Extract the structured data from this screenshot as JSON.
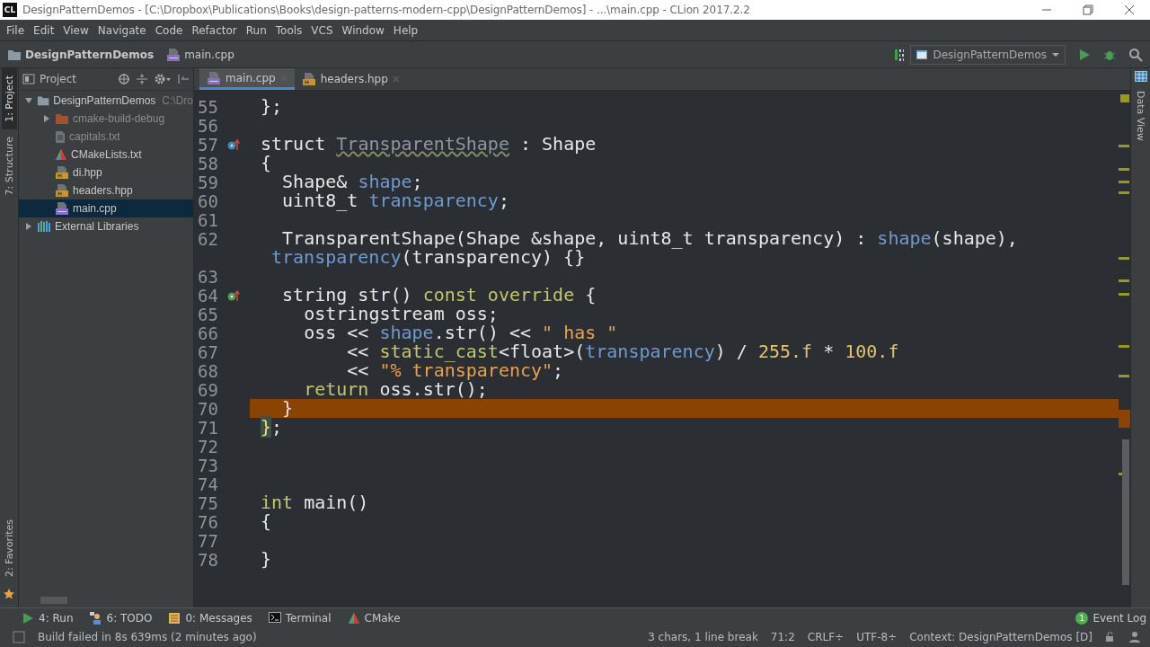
{
  "window": {
    "logo": "CL",
    "title": "DesignPatternDemos - [C:\\Dropbox\\Publications\\Books\\design-patterns-modern-cpp\\DesignPatternDemos] - ...\\main.cpp - CLion 2017.2.2"
  },
  "menu": [
    "File",
    "Edit",
    "View",
    "Navigate",
    "Code",
    "Refactor",
    "Run",
    "Tools",
    "VCS",
    "Window",
    "Help"
  ],
  "breadcrumbs": [
    {
      "kind": "folder",
      "label": "DesignPatternDemos"
    },
    {
      "kind": "cpp",
      "label": "main.cpp"
    }
  ],
  "run_config": {
    "label": "DesignPatternDemos"
  },
  "left_tool_windows": [
    {
      "label": "1: Project",
      "selected": true
    },
    {
      "label": "7: Structure",
      "selected": false
    }
  ],
  "left_bottom_tool_windows": [
    {
      "label": "2: Favorites",
      "selected": false
    }
  ],
  "right_tool_windows": [
    {
      "label": "Data View",
      "selected": false
    }
  ],
  "project_panel": {
    "title": "Project",
    "tree": [
      {
        "kind": "folder",
        "label": "DesignPatternDemos",
        "path": "C:\\Dro",
        "expanded": true,
        "selected": false,
        "excluded": false,
        "children": [
          {
            "kind": "excluded-folder",
            "label": "cmake-build-debug",
            "expanded": false,
            "selected": false,
            "excluded": true
          },
          {
            "kind": "text",
            "label": "capitals.txt",
            "selected": false,
            "excluded": true
          },
          {
            "kind": "cmake",
            "label": "CMakeLists.txt",
            "selected": false,
            "excluded": false
          },
          {
            "kind": "header",
            "label": "di.hpp",
            "selected": false,
            "excluded": false
          },
          {
            "kind": "header",
            "label": "headers.hpp",
            "selected": false,
            "excluded": false
          },
          {
            "kind": "cpp",
            "label": "main.cpp",
            "selected": true,
            "excluded": false
          }
        ]
      },
      {
        "kind": "libraries",
        "label": "External Libraries",
        "expanded": false,
        "selected": false,
        "excluded": false
      }
    ]
  },
  "editor_tabs": [
    {
      "kind": "cpp",
      "label": "main.cpp",
      "selected": true
    },
    {
      "kind": "header",
      "label": "headers.hpp",
      "selected": false
    }
  ],
  "code_lines": [
    {
      "kind": "line",
      "number": "55",
      "tokens": [
        {
          "kind": "plain",
          "text": "};"
        }
      ]
    },
    {
      "kind": "line",
      "number": "56"
    },
    {
      "kind": "overridden",
      "number": "57",
      "tokens": [
        {
          "kind": "plain",
          "text": "struct "
        },
        {
          "kind": "unused",
          "text": "TransparentShape"
        },
        {
          "kind": "plain",
          "text": " : Shape"
        }
      ]
    },
    {
      "kind": "line",
      "number": "58",
      "tokens": [
        {
          "kind": "plain",
          "text": "{"
        }
      ]
    },
    {
      "kind": "line",
      "number": "59",
      "tokens": [
        {
          "kind": "plain",
          "text": "  Shape& "
        },
        {
          "kind": "field",
          "text": "shape"
        },
        {
          "kind": "plain",
          "text": ";"
        }
      ]
    },
    {
      "kind": "line",
      "number": "60",
      "tokens": [
        {
          "kind": "plain",
          "text": "  uint8_t "
        },
        {
          "kind": "field",
          "text": "transparency"
        },
        {
          "kind": "plain",
          "text": ";"
        }
      ]
    },
    {
      "kind": "line",
      "number": "61"
    },
    {
      "kind": "line",
      "number": "62",
      "tokens": [
        {
          "kind": "plain",
          "text": "  TransparentShape(Shape &shape, uint8_t transparency) : "
        },
        {
          "kind": "field",
          "text": "shape"
        },
        {
          "kind": "plain",
          "text": "(shape),"
        }
      ]
    },
    {
      "kind": "wrap",
      "tokens": [
        {
          "kind": "field",
          "text": "transparency"
        },
        {
          "kind": "plain",
          "text": "(transparency) {}"
        }
      ]
    },
    {
      "kind": "line",
      "number": "63"
    },
    {
      "kind": "overriding",
      "number": "64",
      "tokens": [
        {
          "kind": "plain",
          "text": "  string str() "
        },
        {
          "kind": "keyword",
          "text": "const override"
        },
        {
          "kind": "plain",
          "text": " {"
        }
      ]
    },
    {
      "kind": "line",
      "number": "65",
      "tokens": [
        {
          "kind": "plain",
          "text": "    ostringstream oss;"
        }
      ]
    },
    {
      "kind": "line",
      "number": "66",
      "tokens": [
        {
          "kind": "plain",
          "text": "    oss << "
        },
        {
          "kind": "field",
          "text": "shape"
        },
        {
          "kind": "plain",
          "text": ".str() << "
        },
        {
          "kind": "string",
          "text": "\" has \""
        }
      ]
    },
    {
      "kind": "line",
      "number": "67",
      "tokens": [
        {
          "kind": "plain",
          "text": "        << "
        },
        {
          "kind": "keyword",
          "text": "static_cast"
        },
        {
          "kind": "plain",
          "text": "<float>("
        },
        {
          "kind": "field",
          "text": "transparency"
        },
        {
          "kind": "plain",
          "text": ") / "
        },
        {
          "kind": "number",
          "text": "255.f"
        },
        {
          "kind": "plain",
          "text": " * "
        },
        {
          "kind": "number",
          "text": "100.f"
        }
      ]
    },
    {
      "kind": "line",
      "number": "68",
      "tokens": [
        {
          "kind": "plain",
          "text": "        << "
        },
        {
          "kind": "string",
          "text": "\"% transparency\""
        },
        {
          "kind": "plain",
          "text": ";"
        }
      ]
    },
    {
      "kind": "line",
      "number": "69",
      "tokens": [
        {
          "kind": "keyword",
          "text": "    return"
        },
        {
          "kind": "plain",
          "text": " oss.str();"
        }
      ]
    },
    {
      "kind": "line",
      "number": "70",
      "current": true,
      "tokens": [
        {
          "kind": "plain",
          "text": "  }"
        }
      ]
    },
    {
      "kind": "line",
      "number": "71",
      "tokens": [
        {
          "kind": "match",
          "text": "}"
        },
        {
          "kind": "plain",
          "text": ";"
        }
      ]
    },
    {
      "kind": "line",
      "number": "72"
    },
    {
      "kind": "line",
      "number": "73"
    },
    {
      "kind": "line",
      "number": "74"
    },
    {
      "kind": "line",
      "number": "75",
      "tokens": [
        {
          "kind": "keyword",
          "text": "int"
        },
        {
          "kind": "plain",
          "text": " main()"
        }
      ]
    },
    {
      "kind": "line",
      "number": "76",
      "tokens": [
        {
          "kind": "plain",
          "text": "{"
        }
      ]
    },
    {
      "kind": "line",
      "number": "77"
    },
    {
      "kind": "line",
      "number": "78",
      "tokens": [
        {
          "kind": "plain",
          "text": "}"
        }
      ]
    }
  ],
  "bottom_tool_windows": [
    {
      "kind": "run",
      "label": "4: Run"
    },
    {
      "kind": "todo",
      "label": "6: TODO"
    },
    {
      "kind": "messages",
      "label": "0: Messages"
    },
    {
      "kind": "terminal",
      "label": "Terminal"
    },
    {
      "kind": "cmake",
      "label": "CMake"
    }
  ],
  "event_log": {
    "count": "1",
    "label": "Event Log"
  },
  "status_bar": {
    "message": "Build failed in 8s 639ms (2 minutes ago)",
    "items": [
      "3 chars, 1 line break",
      "71:2",
      "CRLF÷",
      "UTF-8÷",
      "Context: DesignPatternDemos [D]"
    ]
  }
}
